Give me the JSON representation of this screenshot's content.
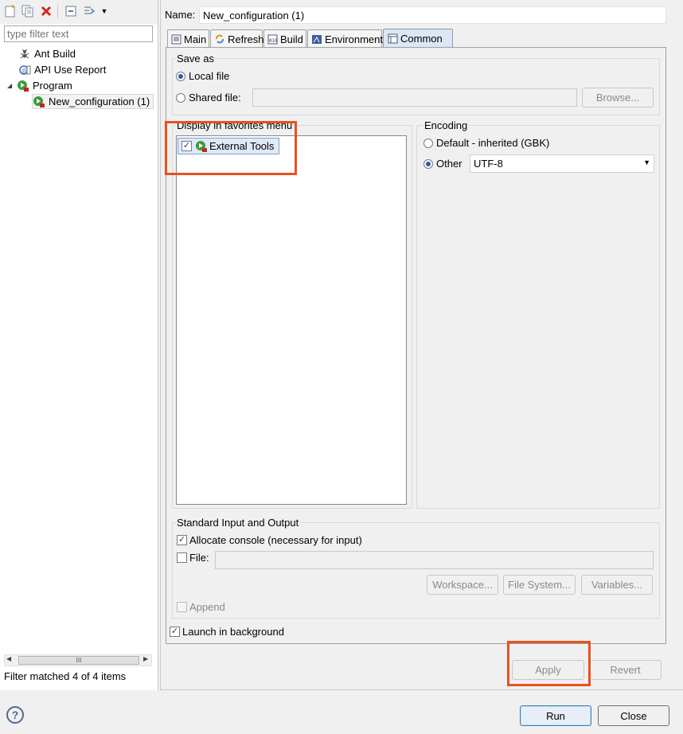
{
  "left": {
    "toolbar_icons": [
      "new-configuration-icon",
      "duplicate-icon",
      "delete-icon",
      "collapse-all-icon",
      "filter-icon",
      "dropdown-arrow-icon"
    ],
    "filter_placeholder": "type filter text",
    "tree": [
      {
        "label": "Ant Build",
        "icon": "ant-icon"
      },
      {
        "label": "API Use Report",
        "icon": "api-report-icon"
      },
      {
        "label": "Program",
        "icon": "program-icon"
      },
      {
        "label": "New_configuration (1)",
        "icon": "program-config-icon"
      }
    ],
    "scroll_grip": "III",
    "status": "Filter matched 4 of 4 items"
  },
  "right": {
    "name_label": "Name:",
    "name_value": "New_configuration (1)",
    "tabs": [
      {
        "label": "Main",
        "icon": "main-tab-icon"
      },
      {
        "label": "Refresh",
        "icon": "refresh-icon"
      },
      {
        "label": "Build",
        "icon": "build-icon"
      },
      {
        "label": "Environment",
        "icon": "environment-icon"
      },
      {
        "label": "Common",
        "icon": "common-tab-icon"
      }
    ],
    "save_as": {
      "title": "Save as",
      "local_file": "Local file",
      "shared_file": "Shared file:",
      "browse": "Browse..."
    },
    "favorites": {
      "title": "Display in favorites menu",
      "items": [
        {
          "label": "External Tools",
          "checked": true
        }
      ]
    },
    "encoding": {
      "title": "Encoding",
      "default_label": "Default - inherited (GBK)",
      "other_label": "Other",
      "other_value": "UTF-8"
    },
    "stdio": {
      "title": "Standard Input and Output",
      "allocate_console": "Allocate console (necessary for input)",
      "file_label": "File:",
      "workspace": "Workspace...",
      "file_system": "File System...",
      "variables": "Variables...",
      "append": "Append"
    },
    "launch_background": "Launch in background",
    "apply": "Apply",
    "revert": "Revert"
  },
  "footer": {
    "help": "?",
    "run": "Run",
    "close": "Close"
  },
  "colors": {
    "highlight": "#e8511f",
    "selected_tab": "#dce6f4"
  }
}
